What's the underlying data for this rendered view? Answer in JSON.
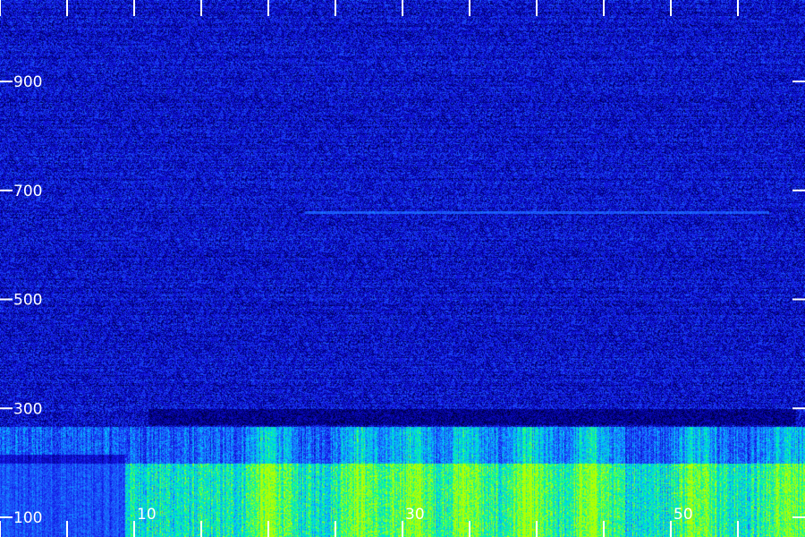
{
  "chart_data": {
    "type": "heatmap",
    "title": "",
    "xlabel": "",
    "ylabel": "",
    "ylim": [
      100,
      1000
    ],
    "y_ticks": [
      {
        "value": 900,
        "label": "900"
      },
      {
        "value": 700,
        "label": "700"
      },
      {
        "value": 500,
        "label": "500"
      },
      {
        "value": 300,
        "label": "300"
      },
      {
        "value": 100,
        "label": "100"
      }
    ],
    "x_tick_count": 12,
    "x_labels": [
      {
        "tick": 2,
        "label": "10"
      },
      {
        "tick": 6,
        "label": "30"
      },
      {
        "tick": 10,
        "label": "50"
      }
    ],
    "colormap": [
      "#000000",
      "#00008c",
      "#1414e6",
      "#1e64ff",
      "#00c8ff",
      "#00ff96",
      "#b4ff00"
    ],
    "noise_floor_level": 0.25,
    "low_band": {
      "from": 100,
      "to": 300,
      "level": 0.6
    },
    "hot_band": {
      "from": 100,
      "to": 200,
      "level": 0.8
    },
    "dark_band": {
      "from": 280,
      "to": 300,
      "level": 0.05
    },
    "faint_line": {
      "at": 660,
      "level": 0.5
    }
  },
  "colors": {
    "background": "#000000",
    "ticks": "#ffffff",
    "labels": "#ffffff"
  }
}
